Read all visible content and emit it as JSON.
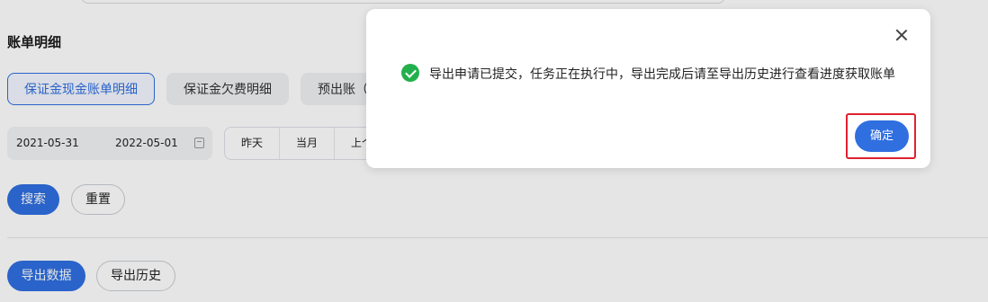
{
  "section": {
    "title": "账单明细"
  },
  "tabs": [
    {
      "label": "保证金现金账单明细",
      "active": true
    },
    {
      "label": "保证金欠费明细",
      "active": false
    },
    {
      "label": "预出账（",
      "active": false
    }
  ],
  "filters": {
    "start_date": "2021-05-31",
    "end_date": "2022-05-01",
    "quick_dates": [
      "昨天",
      "当月",
      "上个"
    ]
  },
  "actions": {
    "search_label": "搜索",
    "reset_label": "重置",
    "export_label": "导出数据",
    "history_label": "导出历史"
  },
  "modal": {
    "message": "导出申请已提交，任务正在执行中，导出完成后请至导出历史进行查看进度获取账单",
    "confirm_label": "确定"
  },
  "colors": {
    "primary": "#2f6fe0",
    "success": "#23b04c",
    "highlight": "#e0212f"
  }
}
